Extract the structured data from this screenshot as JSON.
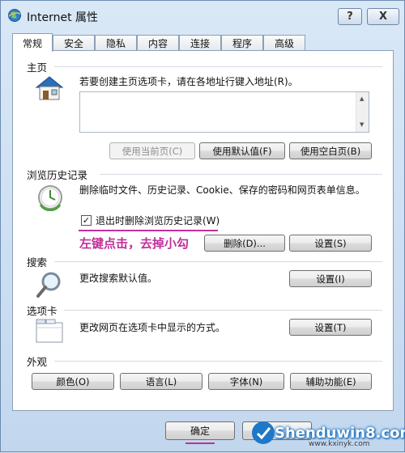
{
  "window": {
    "title": "Internet 属性",
    "help_label": "?",
    "close_label": "X"
  },
  "tabs": [
    {
      "label": "常规",
      "active": true
    },
    {
      "label": "安全"
    },
    {
      "label": "隐私"
    },
    {
      "label": "内容"
    },
    {
      "label": "连接"
    },
    {
      "label": "程序"
    },
    {
      "label": "高级"
    }
  ],
  "homepage": {
    "section_label": "主页",
    "instruction": "若要创建主页选项卡，请在各地址行键入地址(R)。",
    "url_value": "",
    "use_current_label": "使用当前页(C)",
    "use_default_label": "使用默认值(F)",
    "use_blank_label": "使用空白页(B)"
  },
  "history": {
    "section_label": "浏览历史记录",
    "description": "删除临时文件、历史记录、Cookie、保存的密码和网页表单信息。",
    "delete_on_exit_label": "退出时删除浏览历史记录(W)",
    "delete_on_exit_checked": true,
    "checkbox_mark": "✓",
    "delete_label": "删除(D)...",
    "settings_label": "设置(S)"
  },
  "annotation": {
    "text": "左键点击，去掉小勾",
    "color": "#c0309a"
  },
  "search": {
    "section_label": "搜索",
    "description": "更改搜索默认值。",
    "settings_label": "设置(I)"
  },
  "tabs_section": {
    "section_label": "选项卡",
    "description": "更改网页在选项卡中显示的方式。",
    "settings_label": "设置(T)"
  },
  "appearance": {
    "section_label": "外观",
    "colors_label": "颜色(O)",
    "languages_label": "语言(L)",
    "fonts_label": "字体(N)",
    "accessibility_label": "辅助功能(E)"
  },
  "footer": {
    "ok_label": "确定"
  },
  "watermark": {
    "main": "Shenduwin8.com",
    "sub": "www.kxinyk.com"
  }
}
